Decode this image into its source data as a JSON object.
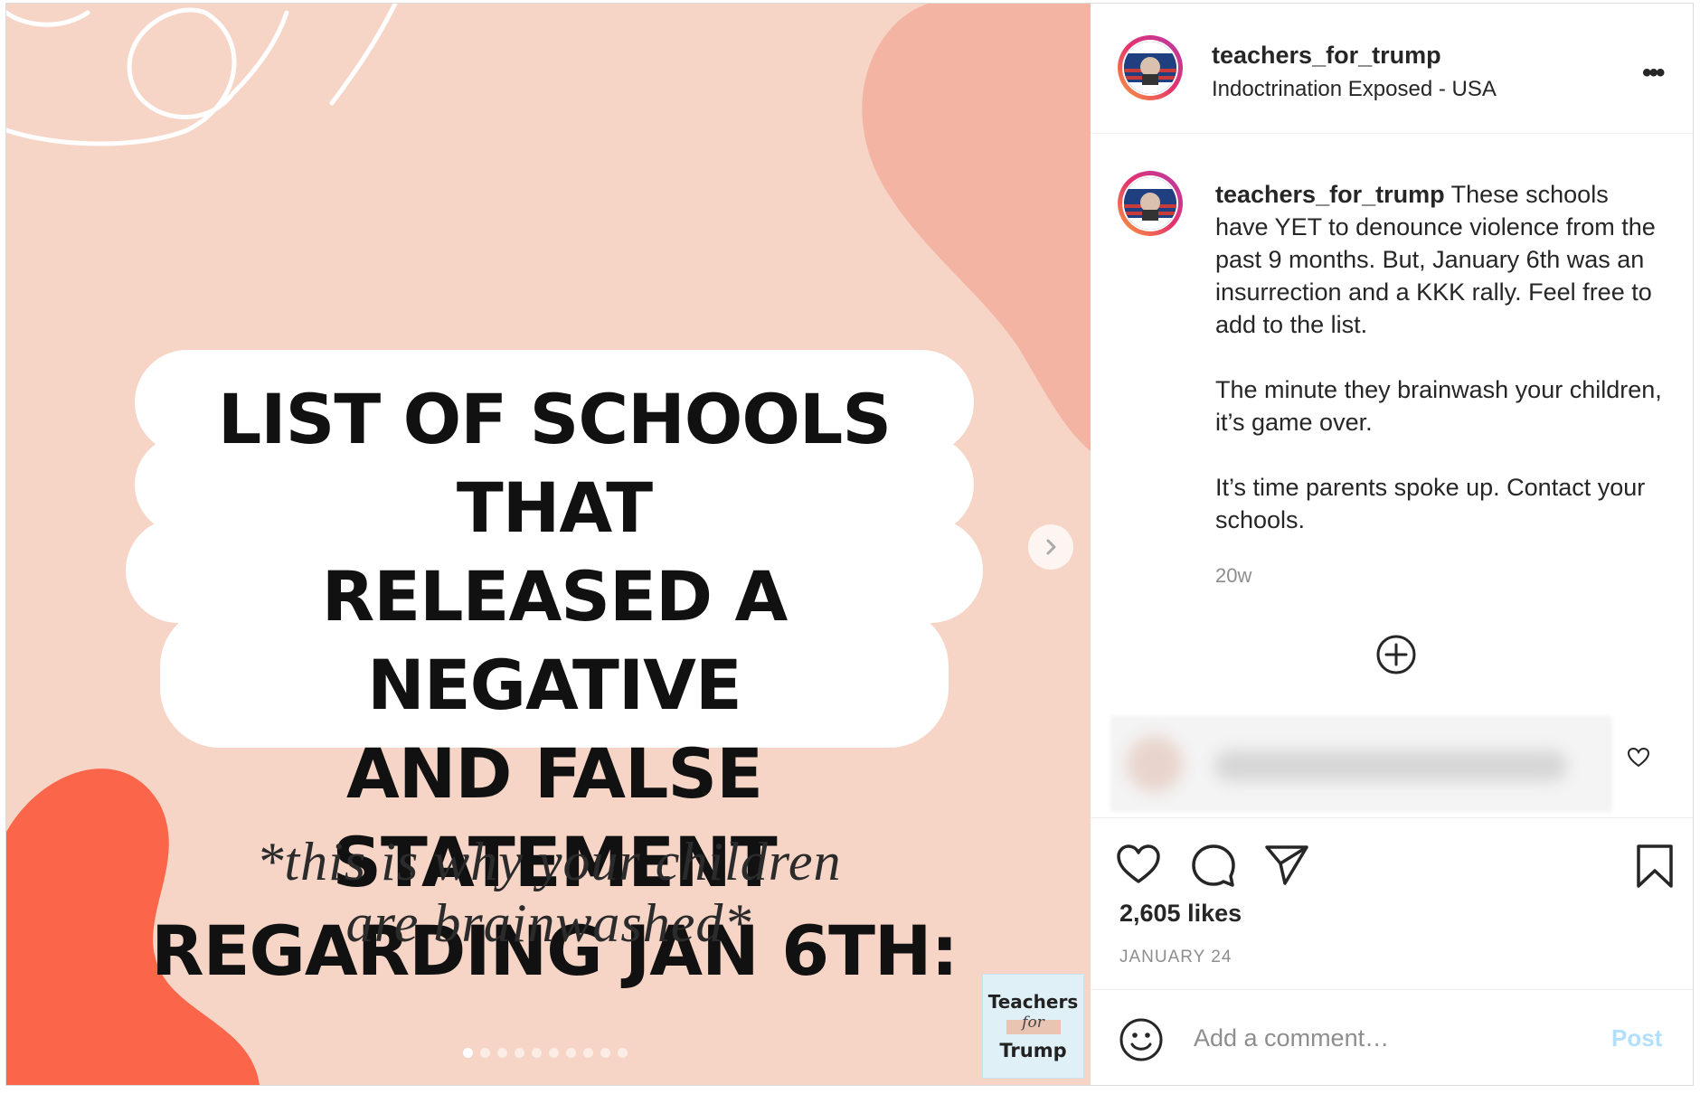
{
  "post": {
    "image": {
      "headline_lines": [
        "LIST OF SCHOOLS THAT",
        "RELEASED A NEGATIVE",
        "AND FALSE STATEMENT",
        "REGARDING JAN 6TH:"
      ],
      "subtitle_lines": [
        "*this is why your children",
        "are brainwashed*"
      ],
      "watermark": {
        "top": "Teachers",
        "middle": "for",
        "bottom": "Trump"
      },
      "carousel_count": 10,
      "carousel_active_index": 0,
      "colors": {
        "background": "#f6d5c7",
        "blob_pink": "#f4b4a3",
        "blob_coral": "#fb6549"
      }
    },
    "header": {
      "username": "teachers_for_trump",
      "location": "Indoctrination Exposed - USA",
      "more_icon": "more-horizontal-icon"
    },
    "caption": {
      "username": "teachers_for_trump",
      "text": "These schools have YET to denounce violence from the past 9 months. But, January 6th was an insurrection and a KKK rally. Feel free to add to the list.\n\nThe minute they brainwash your children, it’s game over.\n\nIt’s time parents spoke up. Contact your schools.",
      "time_ago": "20w"
    },
    "likes": "2,605 likes",
    "date": "JANUARY 24",
    "composer": {
      "placeholder": "Add a comment…",
      "post_label": "Post"
    },
    "icons": [
      "heart-icon",
      "comment-icon",
      "share-icon",
      "bookmark-icon",
      "emoji-icon",
      "add-circle-icon",
      "chevron-right-icon"
    ]
  }
}
